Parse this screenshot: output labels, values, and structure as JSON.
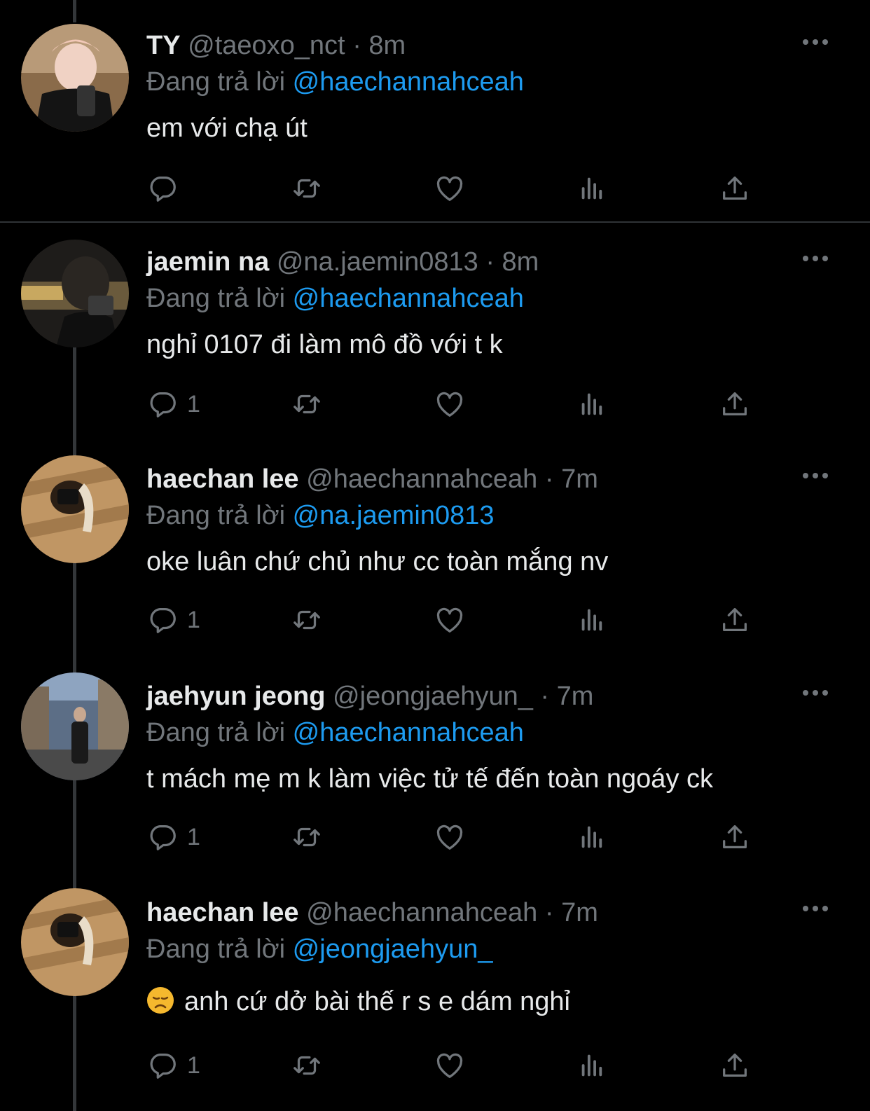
{
  "reply_prefix": "Đang trả lời",
  "tweets": [
    {
      "name": "TY",
      "handle": "@taeoxo_nct",
      "dot": "·",
      "time": "8m",
      "reply_to": "@haechannahceah",
      "text": "em với chạ út",
      "reply_count": "",
      "avatar": "avatar-ty"
    },
    {
      "name": "jaemin na",
      "handle": "@na.jaemin0813",
      "dot": "·",
      "time": "8m",
      "reply_to": "@haechannahceah",
      "text": "nghỉ 0107 đi làm mô đồ với t k",
      "reply_count": "1",
      "avatar": "avatar-jaemin"
    },
    {
      "name": "haechan lee",
      "handle": "@haechannahceah",
      "dot": "·",
      "time": "7m",
      "reply_to": "@na.jaemin0813",
      "text": "oke luân chứ chủ như cc toàn mắng nv",
      "reply_count": "1",
      "avatar": "avatar-haechan"
    },
    {
      "name": "jaehyun jeong",
      "handle": "@jeongjaehyun_",
      "dot": "·",
      "time": "7m",
      "reply_to": "@haechannahceah",
      "text": "t mách mẹ m k làm việc tử tế đến toàn ngoáy ck",
      "reply_count": "1",
      "avatar": "avatar-jaehyun"
    },
    {
      "name": "haechan lee",
      "handle": "@haechannahceah",
      "dot": "·",
      "time": "7m",
      "reply_to": "@jeongjaehyun_",
      "text": "anh cứ dở bài thế r s e dám nghỉ",
      "emoji": "disappointed-face-emoji",
      "reply_count": "1",
      "avatar": "avatar-haechan"
    }
  ],
  "icons": {
    "reply": "reply-icon",
    "retweet": "retweet-icon",
    "like": "like-icon",
    "views": "views-icon",
    "share": "share-icon",
    "more": "more-icon"
  },
  "colors": {
    "background": "#000000",
    "text": "#e7e9ea",
    "secondary": "#71767b",
    "mention": "#1d9bf0",
    "thread_line": "#333639"
  }
}
